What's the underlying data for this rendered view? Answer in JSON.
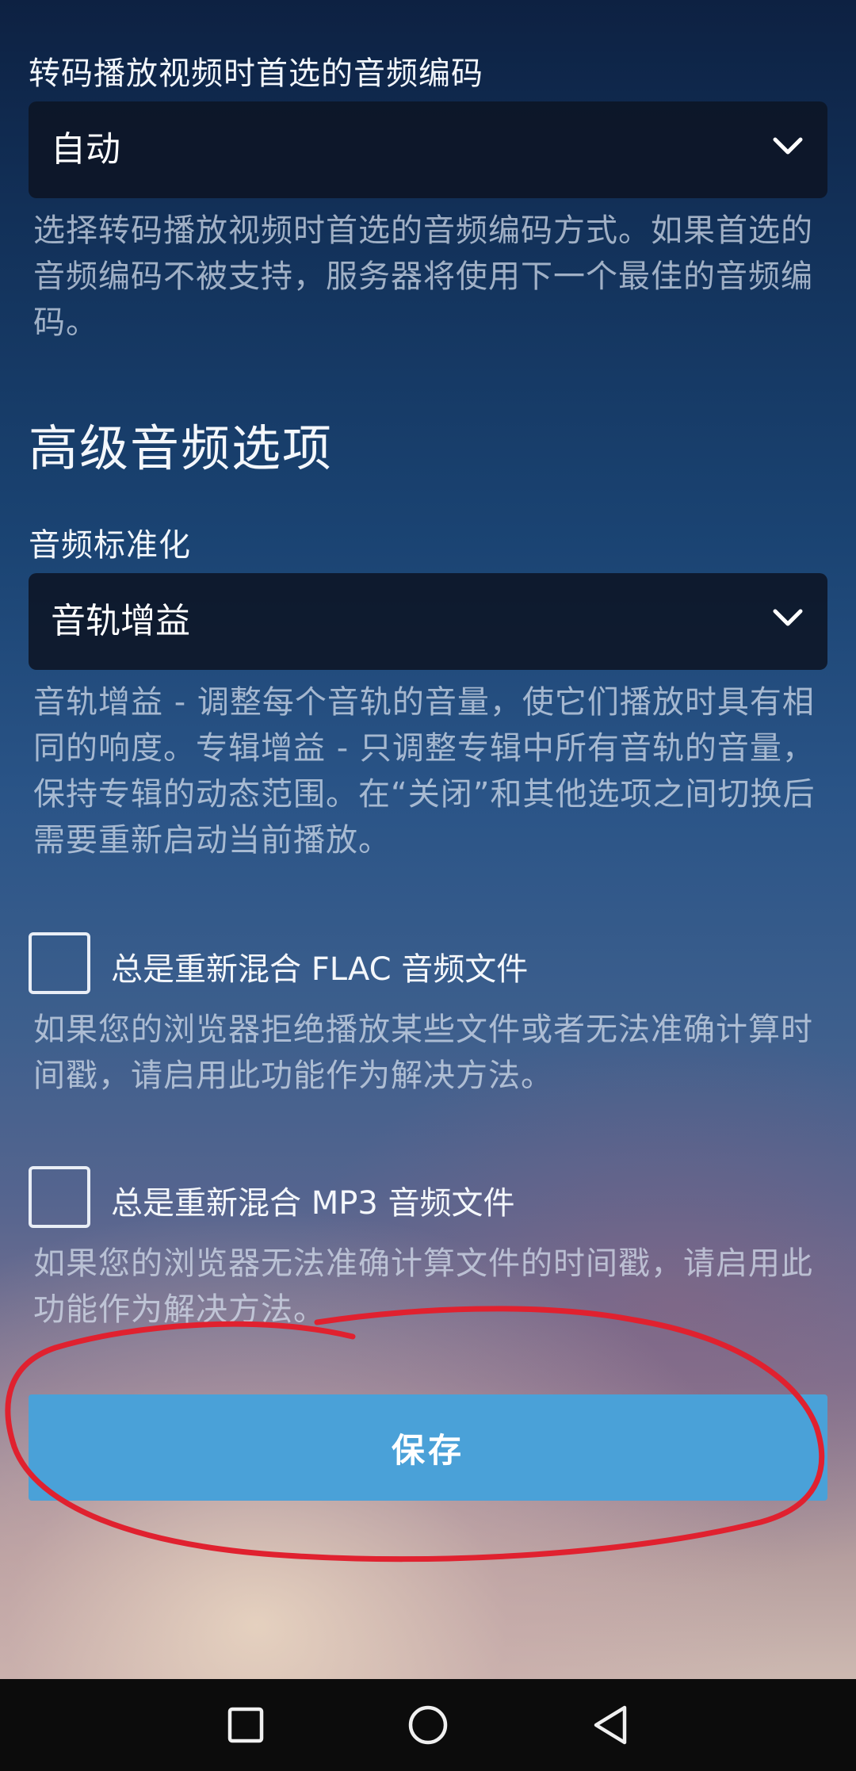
{
  "transcode_audio": {
    "label": "转码播放视频时首选的音频编码",
    "selected_value": "自动",
    "help": "选择转码播放视频时首选的音频编码方式。如果首选的音频编码不被支持，服务器将使用下一个最佳的音频编码。"
  },
  "advanced_audio": {
    "heading": "高级音频选项"
  },
  "normalization": {
    "label": "音频标准化",
    "selected_value": "音轨增益",
    "help": "音轨增益 - 调整每个音轨的音量，使它们播放时具有相同的响度。专辑增益 - 只调整专辑中所有音轨的音量，保持专辑的动态范围。在“关闭”和其他选项之间切换后需要重新启动当前播放。"
  },
  "remux_flac": {
    "label": "总是重新混合 FLAC 音频文件",
    "checked": false,
    "help": "如果您的浏览器拒绝播放某些文件或者无法准确计算时间戳，请启用此功能作为解决方法。"
  },
  "remux_mp3": {
    "label": "总是重新混合 MP3 音频文件",
    "checked": false,
    "help": "如果您的浏览器无法准确计算文件的时间戳，请启用此功能作为解决方法。"
  },
  "save_button": {
    "label": "保存"
  },
  "annotation": {
    "color": "#e0212f"
  },
  "nav_bar": {
    "icons": [
      "square-recents-icon",
      "circle-home-icon",
      "triangle-back-icon"
    ]
  }
}
